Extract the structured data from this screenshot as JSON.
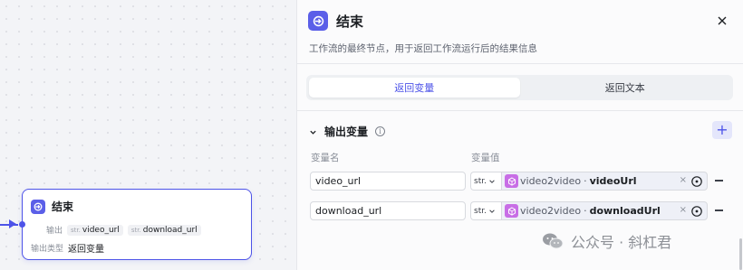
{
  "node": {
    "title": "结束",
    "output_label": "输出",
    "outputs": [
      {
        "type": "str.",
        "name": "video_url"
      },
      {
        "type": "str.",
        "name": "download_url"
      }
    ],
    "output_type_label": "输出类型",
    "output_type_value": "返回变量"
  },
  "panel": {
    "title": "结束",
    "description": "工作流的最终节点，用于返回工作流运行后的结果信息",
    "tabs": [
      "返回变量",
      "返回文本"
    ],
    "active_tab": "返回变量",
    "section_title": "输出变量",
    "col_name": "变量名",
    "col_value": "变量值",
    "rows": [
      {
        "name": "video_url",
        "type": "str.",
        "ref_node": "video2video",
        "ref_var": "videoUrl"
      },
      {
        "name": "download_url",
        "type": "str.",
        "ref_node": "video2video",
        "ref_var": "downloadUrl"
      }
    ]
  },
  "watermark": {
    "text": "公众号 · 斜杠君"
  },
  "colors": {
    "accent": "#4d53e8",
    "cube": "#c86ee6"
  }
}
